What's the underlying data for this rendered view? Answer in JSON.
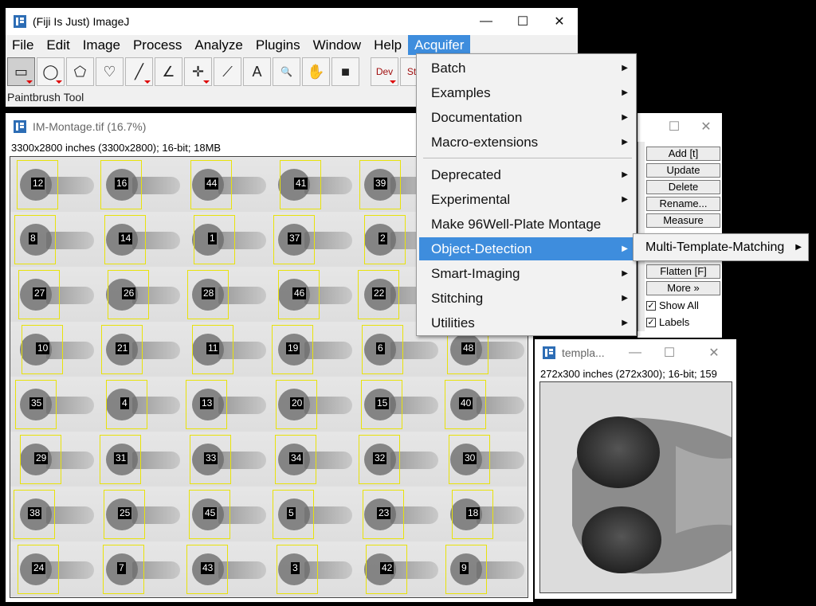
{
  "main_window": {
    "title": "(Fiji Is Just) ImageJ",
    "menu": [
      "File",
      "Edit",
      "Image",
      "Process",
      "Analyze",
      "Plugins",
      "Window",
      "Help",
      "Acquifer"
    ],
    "active_menu": "Acquifer",
    "tools": [
      {
        "name": "rectangle-tool",
        "glyph": "▭"
      },
      {
        "name": "oval-tool",
        "glyph": "◯"
      },
      {
        "name": "polygon-tool",
        "glyph": "⬠"
      },
      {
        "name": "freehand-tool",
        "glyph": "♡"
      },
      {
        "name": "line-tool",
        "glyph": "╱"
      },
      {
        "name": "angle-tool",
        "glyph": "∠"
      },
      {
        "name": "point-tool",
        "glyph": "✛"
      },
      {
        "name": "wand-tool",
        "glyph": "⟋"
      },
      {
        "name": "text-tool",
        "glyph": "A"
      },
      {
        "name": "zoom-tool",
        "glyph": "🔍"
      },
      {
        "name": "hand-tool",
        "glyph": "✋"
      },
      {
        "name": "color-picker-tool",
        "glyph": "■"
      },
      {
        "name": "dev-tool",
        "glyph": "Dev"
      },
      {
        "name": "stk-tool",
        "glyph": "Stk"
      }
    ],
    "status": "Paintbrush Tool"
  },
  "montage_window": {
    "title": "IM-Montage.tif (16.7%)",
    "info": "3300x2800 inches (3300x2800); 16-bit; 18MB",
    "labels": [
      [
        "12",
        "16",
        "44",
        "41",
        "39"
      ],
      [
        "8",
        "14",
        "1",
        "37",
        "2"
      ],
      [
        "27",
        "26",
        "28",
        "46",
        "22"
      ],
      [
        "10",
        "21",
        "11",
        "19",
        "6",
        "48"
      ],
      [
        "35",
        "4",
        "13",
        "20",
        "15",
        "40"
      ],
      [
        "29",
        "31",
        "33",
        "34",
        "32",
        "30"
      ],
      [
        "38",
        "25",
        "45",
        "5",
        "23",
        "18"
      ],
      [
        "24",
        "7",
        "43",
        "3",
        "42",
        "9"
      ]
    ]
  },
  "acquifer_menu": {
    "items_top": [
      "Batch",
      "Examples",
      "Documentation",
      "Macro-extensions"
    ],
    "items_bottom": [
      "Deprecated",
      "Experimental",
      "Make 96Well-Plate Montage",
      "Object-Detection",
      "Smart-Imaging",
      "Stitching",
      "Utilities"
    ],
    "highlighted": "Object-Detection",
    "submenu_item": "Multi-Template-Matching"
  },
  "roi_manager": {
    "buttons": [
      "Add [t]",
      "Update",
      "Delete",
      "Rename...",
      "Measure"
    ],
    "buttons_lower": [
      "Flatten [F]",
      "More »"
    ],
    "checks": [
      {
        "label": "Show All",
        "checked": true
      },
      {
        "label": "Labels",
        "checked": true
      }
    ]
  },
  "template_window": {
    "title": "templa...",
    "info": "272x300 inches (272x300); 16-bit; 159"
  },
  "colors": {
    "accent": "#3e8ddd",
    "roi_box": "#e8e20a"
  }
}
